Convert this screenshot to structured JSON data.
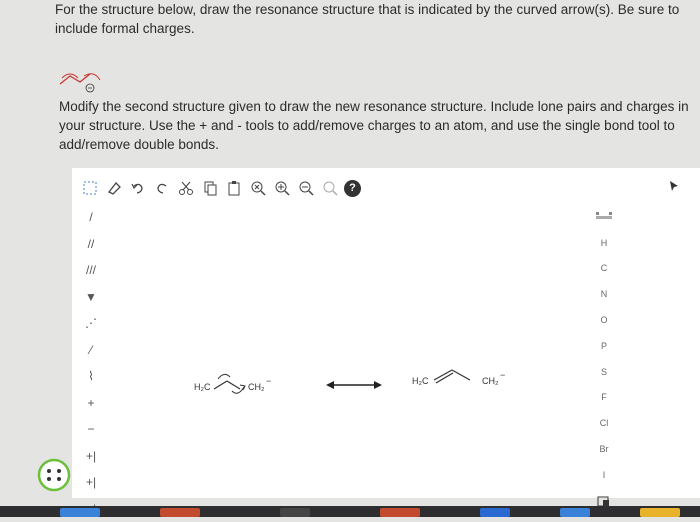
{
  "question1": {
    "text": "For the structure below, draw the resonance structure that is indicated by the curved arrow(s). Be sure to include formal charges."
  },
  "question2": {
    "text": "Modify the second structure given to draw the new resonance structure. Include lone pairs and charges in your structure. Use the + and - tools to add/remove charges to an atom, and use the single bond tool to add/remove double bonds."
  },
  "toolbar": {
    "icons": [
      "select-icon",
      "eraser-icon",
      "undo-icon",
      "redo-icon",
      "cut-icon",
      "copy-icon",
      "paste-icon",
      "zoom-fit-icon",
      "zoom-in-icon",
      "zoom-out-icon",
      "zoom-reset-icon",
      "help-icon"
    ],
    "help_label": "?"
  },
  "left_tools": [
    {
      "icon": "single-bond-icon",
      "glyph": "/"
    },
    {
      "icon": "double-bond-icon",
      "glyph": "//"
    },
    {
      "icon": "triple-bond-icon",
      "glyph": "///"
    },
    {
      "icon": "wedge-bond-icon",
      "glyph": "▼"
    },
    {
      "icon": "hash-bond-icon",
      "glyph": "⋰"
    },
    {
      "icon": "wavy-bond-icon",
      "glyph": "⁄"
    },
    {
      "icon": "chain-icon",
      "glyph": "⌇"
    },
    {
      "icon": "plus-charge-icon",
      "glyph": "+"
    },
    {
      "icon": "minus-charge-icon",
      "glyph": "−"
    },
    {
      "icon": "lone-pair-icon",
      "glyph": "+|"
    },
    {
      "icon": "radical-icon",
      "glyph": "+|"
    },
    {
      "icon": "arrow-icon",
      "glyph": "+|"
    }
  ],
  "right_tools": {
    "elements": [
      "H",
      "C",
      "N",
      "O",
      "P",
      "S",
      "F",
      "Cl",
      "Br",
      "I"
    ]
  },
  "molecule_left": {
    "left_group": "H₂C",
    "right_group": "CH₂",
    "charge": "−"
  },
  "molecule_right": {
    "left_group": "H₂C",
    "right_group": "CH₂",
    "charge": "−"
  },
  "colors": {
    "background": "#e4e4e2",
    "panel": "#ffffff",
    "ring_green": "#6bbf3a",
    "arrow_red": "#c33"
  }
}
